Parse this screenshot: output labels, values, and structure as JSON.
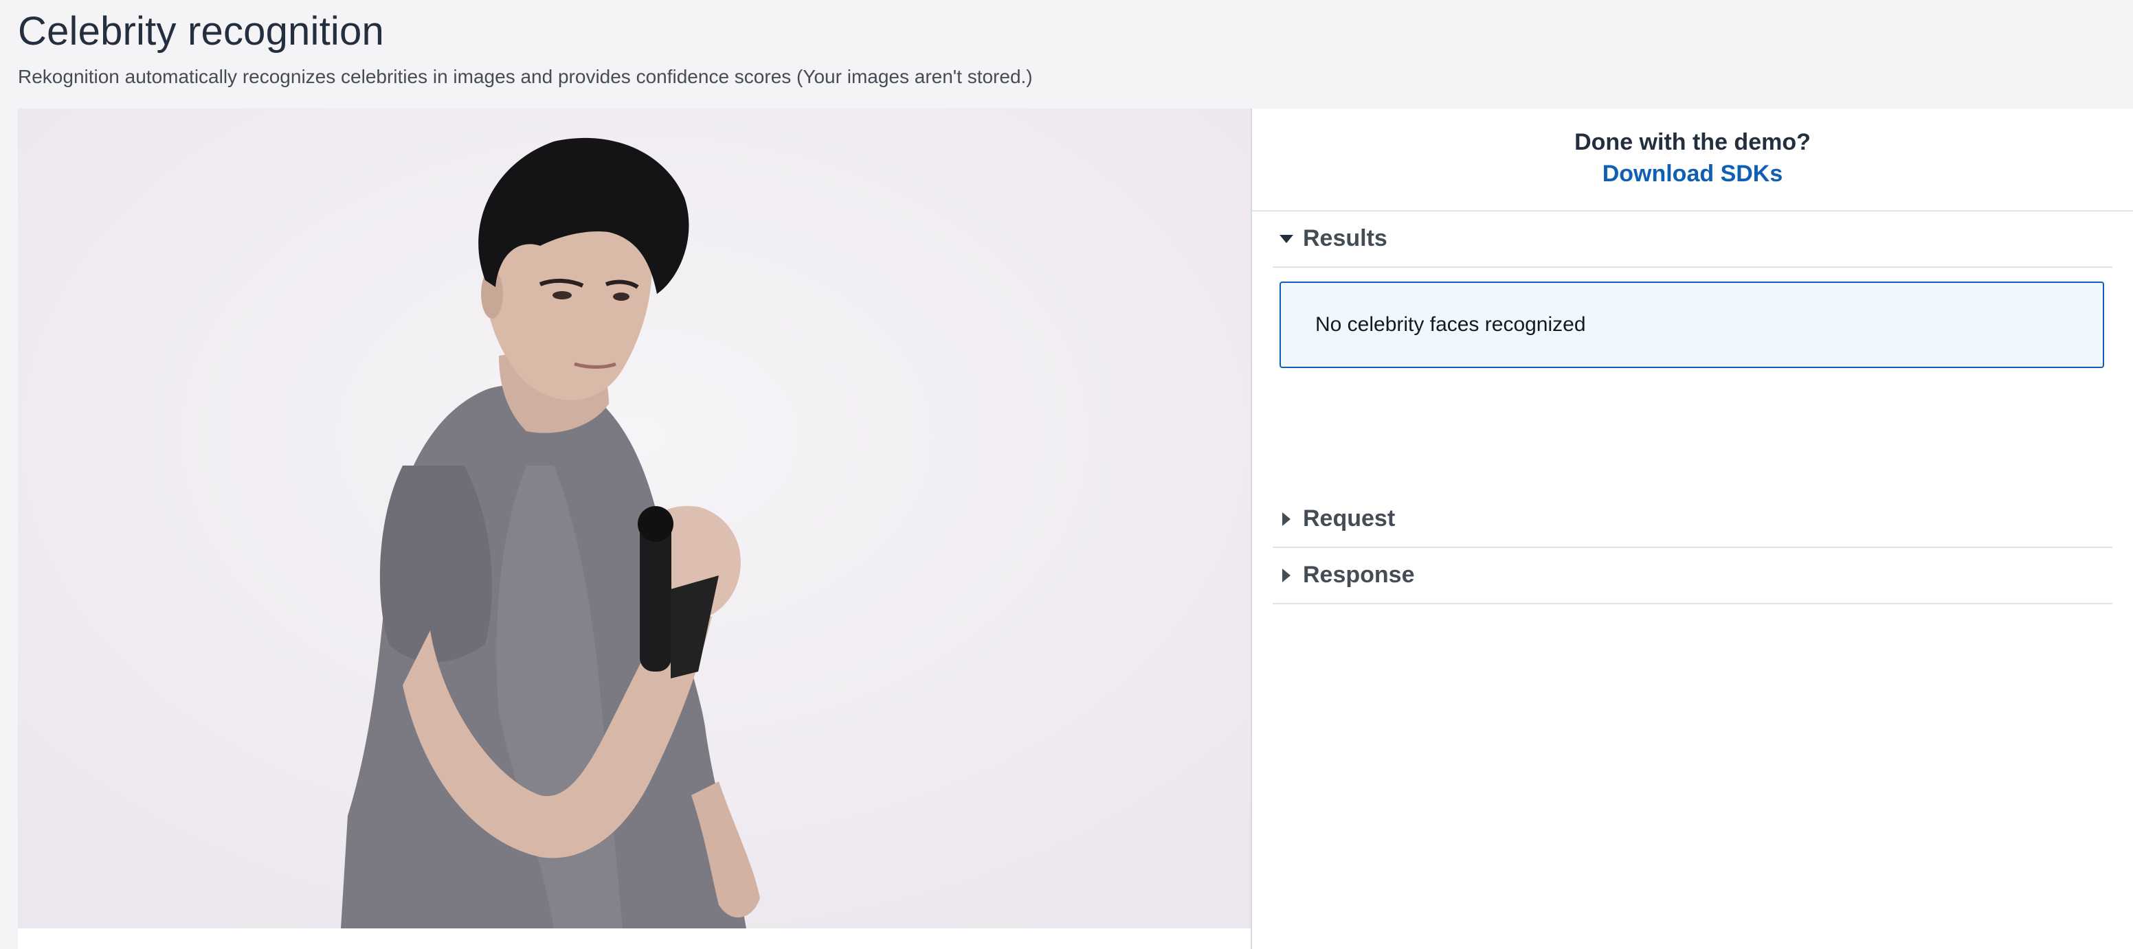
{
  "page": {
    "title": "Celebrity recognition",
    "subtitle": "Rekognition automatically recognizes celebrities in images and provides confidence scores (Your images aren't stored.)"
  },
  "cta": {
    "question": "Done with the demo?",
    "link_label": "Download SDKs"
  },
  "sections": {
    "results": {
      "label": "Results",
      "expanded": true,
      "icon": "caret-down-icon"
    },
    "request": {
      "label": "Request",
      "expanded": false,
      "icon": "caret-right-icon"
    },
    "response": {
      "label": "Response",
      "expanded": false,
      "icon": "caret-right-icon"
    }
  },
  "results": {
    "message": "No celebrity faces recognized"
  },
  "colors": {
    "accent": "#0f5fb3",
    "result_background": "#f0f8fd",
    "page_background": "#f4f4f6"
  }
}
